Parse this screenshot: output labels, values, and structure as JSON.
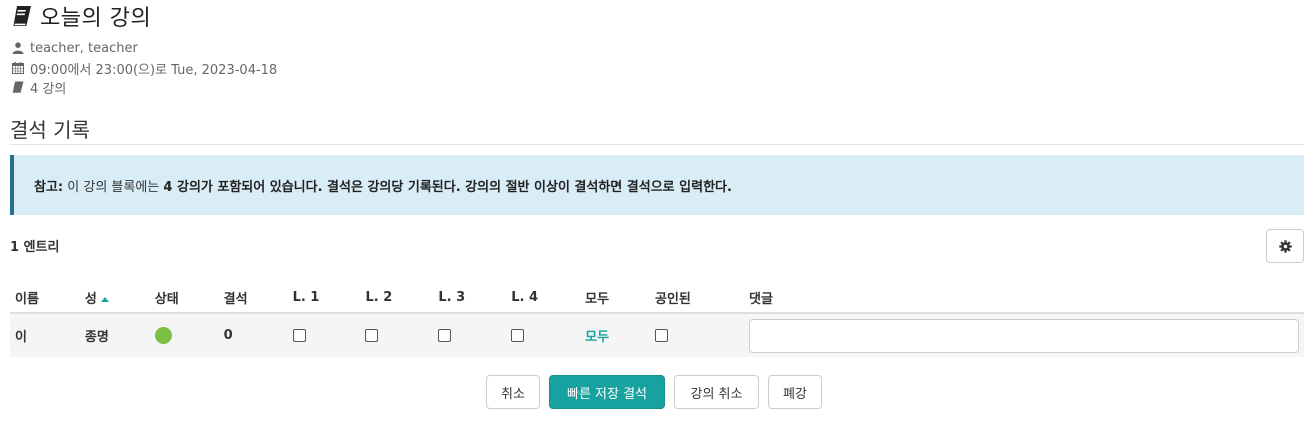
{
  "page": {
    "title": "오늘의 강의",
    "teacher": "teacher, teacher",
    "time": "09:00에서 23:00(으)로 Tue, 2023-04-18",
    "lessons": "4 강의"
  },
  "section": {
    "heading": "결석 기록"
  },
  "alert": {
    "label": "참고:",
    "text1": "이 강의 블록에는",
    "strong": "4 강의가 포함되어 있습니다. 결석은 강의당 기록된다. 강의의 절반 이상이 결석하면 결석으로 입력한다."
  },
  "entries": "1 엔트리",
  "table": {
    "headers": {
      "first_name": "이름",
      "last_name": "성",
      "status": "상태",
      "absences": "결석",
      "l1": "L. 1",
      "l2": "L. 2",
      "l3": "L. 3",
      "l4": "L. 4",
      "all": "모두",
      "excused": "공인된",
      "comment": "댓글"
    },
    "rows": [
      {
        "first_name": "이",
        "last_name": "종명",
        "absences": "0",
        "all_link": "모두",
        "comment": ""
      }
    ]
  },
  "buttons": {
    "cancel": "취소",
    "quick_save": "빠른 저장 결석",
    "cancel_lesson": "강의 취소",
    "close": "폐강"
  },
  "colors": {
    "accent": "#17a2a0",
    "alert_bg": "#d9edf7",
    "status_present": "#7ac143"
  },
  "icons": {
    "title": "book-icon",
    "teacher": "user-icon",
    "time": "calendar-icon",
    "lessons": "book-icon",
    "settings": "gear-icon"
  }
}
